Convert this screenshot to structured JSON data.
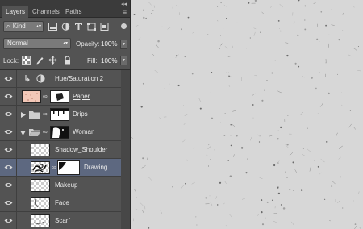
{
  "panel": {
    "tabs": [
      {
        "label": "Layers",
        "active": true
      },
      {
        "label": "Channels",
        "active": false
      },
      {
        "label": "Paths",
        "active": false
      }
    ],
    "collapse_glyph": "◂◂",
    "menu_glyph": "≡"
  },
  "filter": {
    "kind_icon": "⌕",
    "kind_label": "Kind",
    "icons": [
      "pixel-filter-icon",
      "adjustment-filter-icon",
      "type-filter-icon",
      "shape-filter-icon",
      "smart-object-filter-icon"
    ]
  },
  "blend": {
    "mode": "Normal",
    "opacity_label": "Opacity:",
    "opacity_value": "100%"
  },
  "lock": {
    "label": "Lock:",
    "fill_label": "Fill:",
    "fill_value": "100%"
  },
  "layers": [
    {
      "name": "Hue/Saturation 2",
      "type": "adjustment",
      "selected": false
    },
    {
      "name": "Paper",
      "type": "pixel-with-mask",
      "selected": false,
      "underlined": true
    },
    {
      "name": "Drips",
      "type": "group-collapsed",
      "selected": false
    },
    {
      "name": "Woman",
      "type": "group-expanded",
      "selected": false
    },
    {
      "name": "Shadow_Shoulder",
      "type": "pixel",
      "selected": false
    },
    {
      "name": "Drawing",
      "type": "pixel-with-mask",
      "selected": true
    },
    {
      "name": "Makeup",
      "type": "pixel",
      "selected": false
    },
    {
      "name": "Face",
      "type": "pixel",
      "selected": false
    },
    {
      "name": "Scarf",
      "type": "pixel",
      "selected": false
    }
  ],
  "colors": {
    "panel_bg": "#535353",
    "selected_row": "#5d6880",
    "canvas_bg": "#d7d7d7"
  }
}
